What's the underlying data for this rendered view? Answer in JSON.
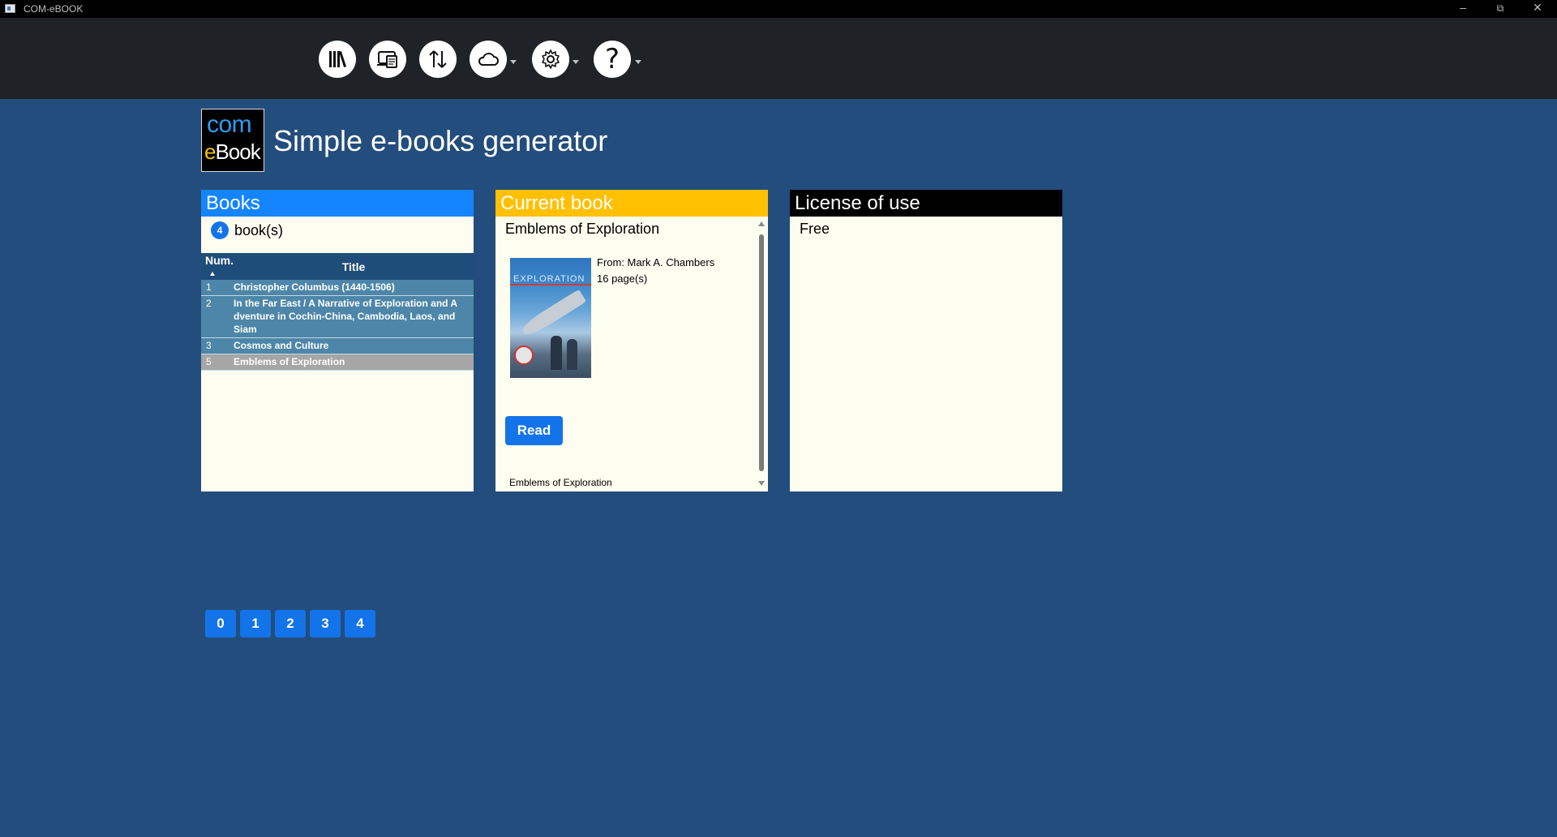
{
  "window": {
    "title": "COM-eBOOK"
  },
  "toolbar": {
    "buttons": [
      {
        "name": "library",
        "icon": "library-icon"
      },
      {
        "name": "devices",
        "icon": "devices-icon"
      },
      {
        "name": "import-export",
        "icon": "sort-arrows-icon"
      },
      {
        "name": "cloud",
        "icon": "cloud-icon",
        "dropdown": true
      },
      {
        "name": "settings",
        "icon": "gear-icon",
        "dropdown": true
      },
      {
        "name": "help",
        "icon": "help-icon",
        "glyph": "?",
        "dropdown": true
      }
    ]
  },
  "header": {
    "logo_top": "com",
    "logo_bottom_e": "e",
    "logo_bottom_rest": "Book",
    "title": "Simple e-books generator"
  },
  "books_panel": {
    "title": "Books",
    "count": "4",
    "count_label": "book(s)",
    "columns": {
      "num": "Num.",
      "title": "Title"
    },
    "rows": [
      {
        "num": "1",
        "title": "Christopher Columbus (1440-1506)",
        "selected": false
      },
      {
        "num": "2",
        "title": "In the Far East / A Narrative of Exploration and A dventure in Cochin-China, Cambodia, Laos, and Siam",
        "selected": false
      },
      {
        "num": "3",
        "title": "Cosmos and Culture",
        "selected": false
      },
      {
        "num": "5",
        "title": "Emblems of Exploration",
        "selected": true
      }
    ]
  },
  "current_panel": {
    "title": "Current book",
    "book_title": "Emblems of Exploration",
    "cover_text": "EXPLORATION",
    "author": "From: Mark A. Chambers",
    "pages": "16 page(s)",
    "read_label": "Read",
    "footer": "Emblems of Exploration"
  },
  "license_panel": {
    "title": "License of use",
    "text": "Free"
  },
  "pager": {
    "pages": [
      "0",
      "1",
      "2",
      "3",
      "4"
    ]
  },
  "colors": {
    "background": "#234d7c",
    "books_header": "#1585ff",
    "current_header": "#ffc000",
    "license_header": "#000000",
    "accent_button": "#1274e8"
  }
}
